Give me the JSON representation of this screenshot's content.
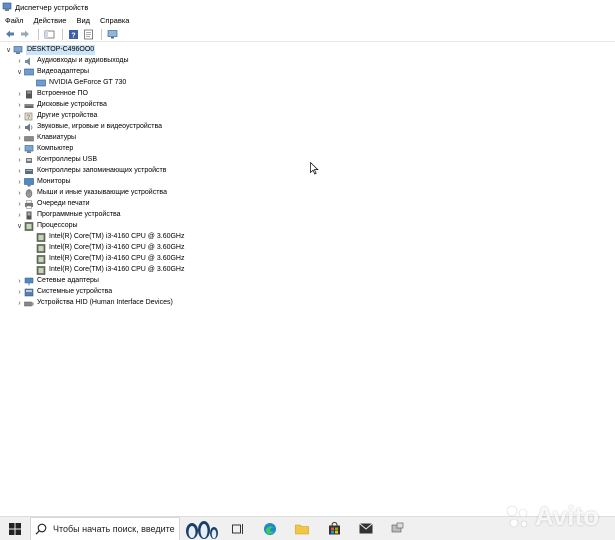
{
  "window": {
    "title": "Диспетчер устройств"
  },
  "menu": [
    "Файл",
    "Действие",
    "Вид",
    "Справка"
  ],
  "tree": {
    "root": "DESKTOP-C496OO0",
    "categories": [
      {
        "label": "Аудиовходы и аудиовыходы",
        "expanded": false
      },
      {
        "label": "Видеоадаптеры",
        "expanded": true,
        "children": [
          "NVIDIA GeForce GT 730"
        ]
      },
      {
        "label": "Встроенное ПО",
        "expanded": false
      },
      {
        "label": "Дисковые устройства",
        "expanded": false
      },
      {
        "label": "Другие устройства",
        "expanded": false
      },
      {
        "label": "Звуковые, игровые и видеоустройства",
        "expanded": false
      },
      {
        "label": "Клавиатуры",
        "expanded": false
      },
      {
        "label": "Компьютер",
        "expanded": false
      },
      {
        "label": "Контроллеры USB",
        "expanded": false
      },
      {
        "label": "Контроллеры запоминающих устройств",
        "expanded": false
      },
      {
        "label": "Мониторы",
        "expanded": false
      },
      {
        "label": "Мыши и иные указывающие устройства",
        "expanded": false
      },
      {
        "label": "Очереди печати",
        "expanded": false
      },
      {
        "label": "Программные устройства",
        "expanded": false
      },
      {
        "label": "Процессоры",
        "expanded": true,
        "children": [
          "Intel(R) Core(TM) i3-4160 CPU @ 3.60GHz",
          "Intel(R) Core(TM) i3-4160 CPU @ 3.60GHz",
          "Intel(R) Core(TM) i3-4160 CPU @ 3.60GHz",
          "Intel(R) Core(TM) i3-4160 CPU @ 3.60GHz"
        ]
      },
      {
        "label": "Сетевые адаптеры",
        "expanded": false
      },
      {
        "label": "Системные устройства",
        "expanded": false
      },
      {
        "label": "Устройства HID (Human Interface Devices)",
        "expanded": false
      }
    ]
  },
  "taskbar": {
    "search_placeholder": "Чтобы начать поиск, введите"
  },
  "watermark": {
    "text": "Avito"
  },
  "colors": {
    "selection": "#cce4f7",
    "taskbar": "#f0f0f0",
    "accent": "#0078d7"
  }
}
